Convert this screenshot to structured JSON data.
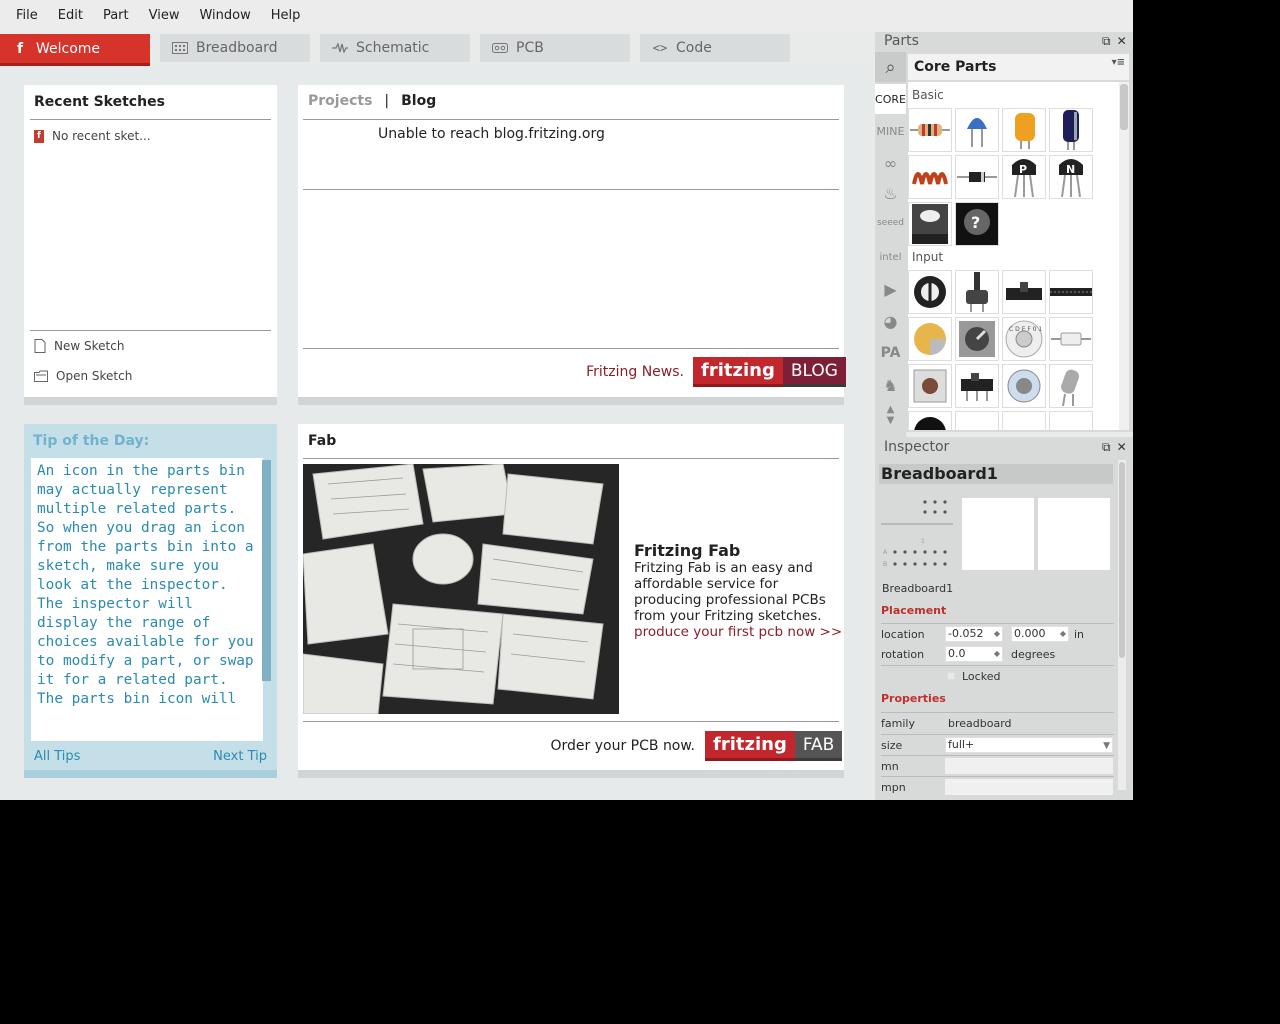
{
  "menu": [
    "File",
    "Edit",
    "Part",
    "View",
    "Window",
    "Help"
  ],
  "tabs": {
    "welcome": "Welcome",
    "breadboard": "Breadboard",
    "schematic": "Schematic",
    "pcb": "PCB",
    "code": "Code"
  },
  "recent": {
    "title": "Recent Sketches",
    "item": "No recent sket...",
    "new": "New Sketch",
    "open": "Open Sketch"
  },
  "blog": {
    "tab_projects": "Projects",
    "tab_sep": "|",
    "tab_blog": "Blog",
    "message": "Unable to reach blog.fritzing.org",
    "news_label": "Fritzing News.",
    "brand_left": "fritzing",
    "brand_right": "BLOG"
  },
  "tip": {
    "title": "Tip of the Day:",
    "text": "An icon in the parts bin may actually represent multiple related parts. So when you drag an icon from the parts bin into a sketch, make sure you look at the inspector. The inspector will display the range of choices available for you to modify a part, or swap it for a related part. The parts bin icon will",
    "all_tips": "All Tips",
    "next_tip": "Next Tip"
  },
  "fab": {
    "title": "Fab",
    "heading": "Fritzing Fab",
    "description": "Fritzing Fab is an easy and affordable service for producing professional PCBs from your Fritzing sketches.",
    "link": "produce your first pcb now >>",
    "order_label": "Order your PCB now.",
    "brand_left": "fritzing",
    "brand_right": "FAB"
  },
  "parts": {
    "dock_title": "Parts",
    "bin_title": "Core Parts",
    "bins": [
      "CORE",
      "MINE"
    ],
    "section_basic": "Basic",
    "section_input": "Input"
  },
  "inspector": {
    "dock_title": "Inspector",
    "title": "Breadboard1",
    "name": "Breadboard1",
    "placement": "Placement",
    "location_label": "location",
    "location_x": "-0.052",
    "location_y": "0.000",
    "location_unit": "in",
    "rotation_label": "rotation",
    "rotation_value": "0.0",
    "rotation_unit": "degrees",
    "locked": "Locked",
    "properties": "Properties",
    "family_label": "family",
    "family_value": "breadboard",
    "size_label": "size",
    "size_value": "full+",
    "mn_label": "mn",
    "mpn_label": "mpn"
  },
  "colors": {
    "accent": "#d6332b",
    "tip_text": "#2a8bb0",
    "link": "#8c1f2a"
  }
}
